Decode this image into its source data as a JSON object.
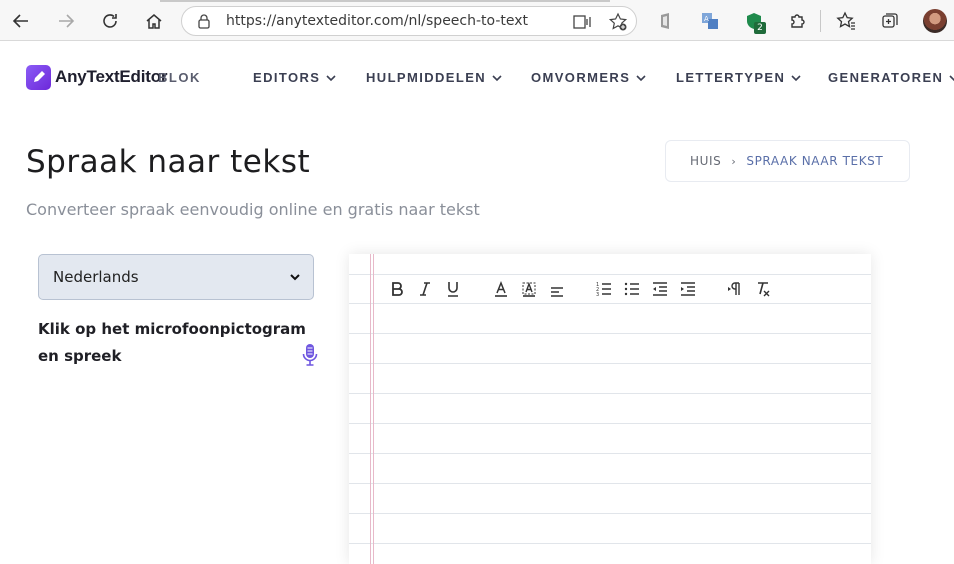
{
  "browser": {
    "url": "https://anytexteditor.com/nl/speech-to-text",
    "extension_badge": "2"
  },
  "site": {
    "logo_text": "AnyTextEditor",
    "nav_overlap": "BLOK",
    "nav": [
      {
        "label": "EDITORS"
      },
      {
        "label": "HULPMIDDELEN"
      },
      {
        "label": "OMVORMERS"
      },
      {
        "label": "LETTERTYPEN"
      },
      {
        "label": "GENERATOREN"
      }
    ]
  },
  "page": {
    "title": "Spraak naar tekst",
    "subtitle": "Converteer spraak eenvoudig online en gratis naar tekst",
    "breadcrumb": {
      "home": "HUIS",
      "current": "SPRAAK NAAR TEKST"
    }
  },
  "controls": {
    "language_selected": "Nederlands",
    "instruction": "Klik op het microfoonpictogram en spreek"
  },
  "editor": {
    "toolbar_icons": [
      "bold-icon",
      "italic-icon",
      "underline-icon",
      "font-color-icon",
      "background-color-icon",
      "align-icon",
      "ordered-list-icon",
      "bullet-list-icon",
      "outdent-icon",
      "indent-icon",
      "text-direction-icon",
      "clear-format-icon"
    ]
  },
  "colors": {
    "accent": "#7c4dff",
    "mic": "#6f57e0",
    "breadcrumb_current": "#5a6fa8",
    "select_bg": "#e3e8f0"
  }
}
